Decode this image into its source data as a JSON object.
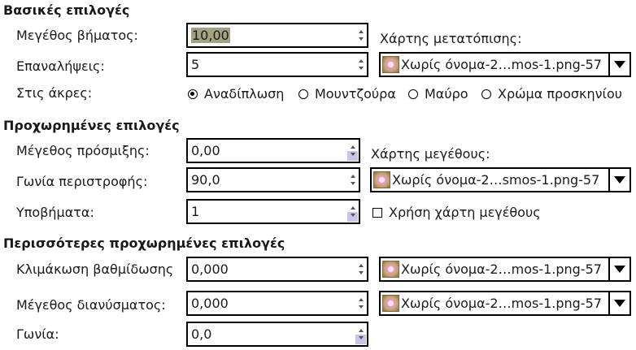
{
  "basic": {
    "title": "Βασικές επιλογές",
    "step_size_label": "Μεγέθος βήματος:",
    "step_size_value": "10,00",
    "iterations_label": "Επαναλήψεις:",
    "iterations_value": "5",
    "edges_label": "Στις άκρες:",
    "displace_map_label": "Χάρτης μετατόπισης:",
    "displace_map_value": "Χωρίς όνομα-2…mos-1.png-57",
    "edge_options": [
      {
        "label": "Αναδίπλωση",
        "selected": true
      },
      {
        "label": "Μουντζούρα",
        "selected": false
      },
      {
        "label": "Μαύρο",
        "selected": false
      },
      {
        "label": "Χρώμα προσκηνίου",
        "selected": false
      }
    ]
  },
  "advanced": {
    "title": "Προχωρημένες επιλογές",
    "smooth_label": "Μέγεθος πρόσμιξης:",
    "smooth_value": "0,00",
    "rotation_label": "Γωνία περιστροφής:",
    "rotation_value": "90,0",
    "substeps_label": "Υποβήματα:",
    "substeps_value": "1",
    "magnitude_map_label": "Χάρτης μεγέθους:",
    "magnitude_map_value": "Χωρίς όνομα-2…smos-1.png-57",
    "use_magnitude_label": "Χρήση χάρτη μεγέθους",
    "use_magnitude_checked": false
  },
  "more_advanced": {
    "title": "Περισσότερες προχωρημένες επιλογές",
    "gradient_scale_label": "Κλιμάκωση βαθμίδωσης",
    "gradient_scale_value": "0,000",
    "gradient_map_value": "Χωρίς όνομα-2…mos-1.png-57",
    "vector_size_label": "Μέγεθος διανύσματος:",
    "vector_size_value": "0,000",
    "vector_map_value": "Χωρίς όνομα-2…mos-1.png-57",
    "angle_label": "Γωνία:",
    "angle_value": "0,0"
  }
}
